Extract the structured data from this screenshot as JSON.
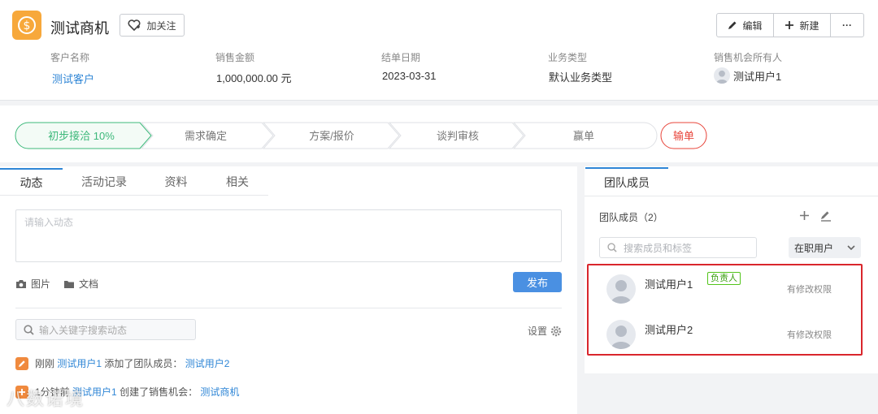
{
  "header": {
    "title": "测试商机",
    "follow_label": "加关注",
    "edit_label": "编辑",
    "new_label": "新建",
    "more_label": "···",
    "logo_symbol": "$",
    "fields": [
      {
        "label": "客户名称",
        "value": "测试客户"
      },
      {
        "label": "销售金额",
        "value": "1,000,000.00 元"
      },
      {
        "label": "结单日期",
        "value": "2023-03-31"
      },
      {
        "label": "业务类型",
        "value": "默认业务类型"
      },
      {
        "label": "销售机会所有人",
        "value": "测试用户1"
      }
    ]
  },
  "stages": {
    "items": [
      "初步接洽 10%",
      "需求确定",
      "方案/报价",
      "谈判审核",
      "赢单"
    ],
    "lose": "输单",
    "active_index": 0,
    "colors": {
      "active": "#3cb87a",
      "lose": "#e8443a",
      "inactive_text": "#777"
    }
  },
  "left": {
    "tabs": [
      "动态",
      "活动记录",
      "资料",
      "相关"
    ],
    "input_placeholder": "请输入动态",
    "attach_image": "图片",
    "attach_doc": "文档",
    "publish_label": "发布",
    "search_placeholder": "输入关键字搜索动态",
    "settings_label": "设置",
    "feed": [
      {
        "time": "刚刚",
        "user": "测试用户1",
        "action": "添加了团队成员：",
        "target": "测试用户2"
      },
      {
        "time": "1分钟前",
        "user": "测试用户1",
        "action": "创建了销售机会：",
        "target": "测试商机"
      }
    ]
  },
  "right": {
    "tab": "团队成员",
    "count_label": "团队成员（2）",
    "search_placeholder": "搜索成员和标签",
    "status_select": "在职用户",
    "members": [
      {
        "name": "测试用户1",
        "badge": "负责人",
        "permission": "有修改权限"
      },
      {
        "name": "测试用户2",
        "badge": "",
        "permission": "有修改权限"
      }
    ]
  },
  "watermark": "八数诺境"
}
